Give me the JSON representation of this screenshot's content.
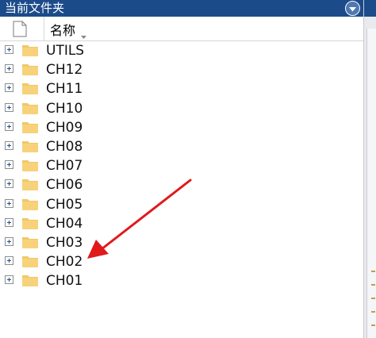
{
  "panel": {
    "title": "当前文件夹",
    "column_name": "名称"
  },
  "folders": [
    {
      "label": "UTILS"
    },
    {
      "label": "CH12"
    },
    {
      "label": "CH11"
    },
    {
      "label": "CH10"
    },
    {
      "label": "CH09"
    },
    {
      "label": "CH08"
    },
    {
      "label": "CH07"
    },
    {
      "label": "CH06"
    },
    {
      "label": "CH05"
    },
    {
      "label": "CH04"
    },
    {
      "label": "CH03"
    },
    {
      "label": "CH02"
    },
    {
      "label": "CH01"
    }
  ],
  "icons": {
    "panel_menu": "chevron-down-circle-icon",
    "file_column": "file-icon",
    "sort": "sort-desc-icon",
    "folder": "folder-icon",
    "expand": "plus-box-icon",
    "annotation": "red-arrow-icon"
  },
  "colors": {
    "titlebar": "#1c4b8a",
    "folder": "#f7d27a",
    "arrow": "#e0191b"
  }
}
